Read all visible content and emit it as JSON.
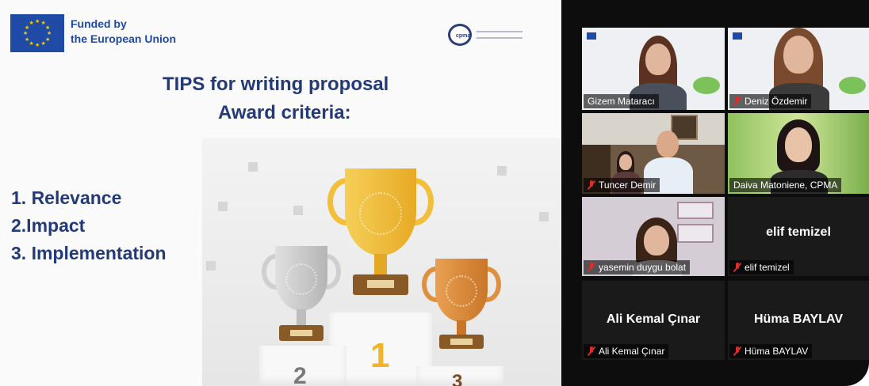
{
  "slide": {
    "funder_line1": "Funded by",
    "funder_line2": "the European Union",
    "partner_logo_text": "cpma",
    "title_line1": "TIPS  for writing proposal",
    "title_line2": "Award criteria:",
    "criteria": [
      "1. Relevance",
      "2.Impact",
      "3. Implementation"
    ],
    "podium_numbers": [
      "2",
      "1",
      "3"
    ]
  },
  "participants": [
    {
      "name": "Gizem Mataracı",
      "video": true,
      "muted": false,
      "active_speaker": true
    },
    {
      "name": "Deniz Özdemir",
      "video": true,
      "muted": true,
      "active_speaker": false
    },
    {
      "name": "Tuncer Demir",
      "video": true,
      "muted": true,
      "active_speaker": false
    },
    {
      "name": "Daiva Matoniene, CPMA",
      "video": true,
      "muted": false,
      "active_speaker": false
    },
    {
      "name": "yasemin duygu bolat",
      "video": true,
      "muted": true,
      "active_speaker": false
    },
    {
      "name": "elif temizel",
      "video": false,
      "muted": true,
      "active_speaker": false
    },
    {
      "name": "Ali Kemal Çınar",
      "video": false,
      "muted": true,
      "active_speaker": false
    },
    {
      "name": "Hüma BAYLAV",
      "video": false,
      "muted": true,
      "active_speaker": false
    }
  ],
  "colors": {
    "title_blue": "#233a78",
    "eu_blue": "#1f4aa5",
    "eu_star": "#f5d000",
    "active_speaker_border": "#dfe05c",
    "muted_icon": "#e02a2a",
    "gold": "#f2bf3a",
    "silver": "#c9c9c9",
    "bronze": "#d98a3a"
  },
  "icons": {
    "muted": "mic-off-icon",
    "eu": "eu-flag-icon"
  }
}
